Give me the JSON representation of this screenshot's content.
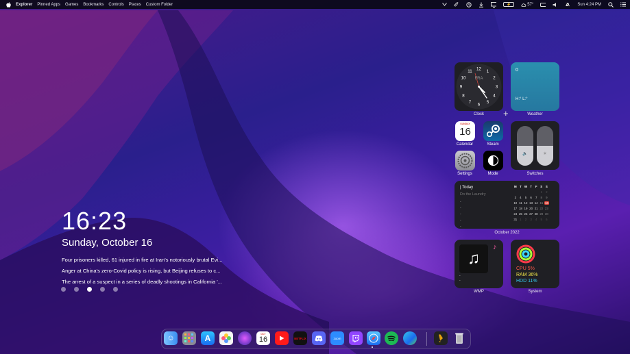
{
  "menubar": {
    "items": [
      "Explorer",
      "Pinned Apps",
      "Games",
      "Bookmarks",
      "Controls",
      "Places",
      "Custom Folder"
    ],
    "temperature": "57°",
    "datetime": "Sun 4:24 PM"
  },
  "lockscreen": {
    "time": "16:23",
    "date": "Sunday, October 16",
    "news": [
      "Four prisoners killed, 61 injured in fire at Iran's notoriously brutal Evi...",
      "Anger at China's zero-Covid policy is rising, but Beijing refuses to c...",
      "The arrest of a suspect in a series of deadly shootings in California '..."
    ],
    "active_page": 3,
    "page_count": 5
  },
  "widgets": {
    "clock": {
      "label": "Clock",
      "city": "FRA",
      "numbers": [
        "12",
        "1",
        "2",
        "3",
        "4",
        "5",
        "6",
        "7",
        "8",
        "9",
        "10",
        "11"
      ]
    },
    "weather": {
      "label": "Weather",
      "temp": "0",
      "hilo": "H:° L:°"
    },
    "calendar_app": {
      "label": "Calendar",
      "weekday": "SUNDAY",
      "day": "16"
    },
    "steam": {
      "label": "Steam"
    },
    "settings": {
      "label": "Settings"
    },
    "mode": {
      "label": "Mode"
    },
    "switches": {
      "label": "Switches",
      "volume_level": 0.5,
      "brightness_level": 0.5
    },
    "calendar_widget": {
      "label": "October 2022",
      "today_label": "Today",
      "event": "Do the Laundry",
      "bullets": [
        "-",
        "-",
        "-",
        "-",
        "-"
      ],
      "weekday_headers": [
        "M",
        "T",
        "W",
        "T",
        "F",
        "S",
        "S"
      ],
      "days": [
        "",
        "",
        "",
        "",
        "",
        "1",
        "2",
        "3",
        "4",
        "5",
        "6",
        "7",
        "8",
        "9",
        "10",
        "11",
        "12",
        "13",
        "14",
        "15",
        "16",
        "17",
        "18",
        "19",
        "20",
        "21",
        "22",
        "23",
        "24",
        "25",
        "26",
        "27",
        "28",
        "29",
        "30",
        "31",
        "1",
        "2",
        "3",
        "4",
        "5",
        "6"
      ],
      "today": "16"
    },
    "wmp": {
      "label": "WMP",
      "lines": [
        "-",
        "-"
      ]
    },
    "system": {
      "label": "System",
      "cpu": "CPU 5%",
      "ram": "RAM 36%",
      "hdd": "HDD 11%"
    }
  },
  "dock": {
    "apps": [
      {
        "name": "Finder"
      },
      {
        "name": "Launchpad"
      },
      {
        "name": "App Store"
      },
      {
        "name": "Photos"
      },
      {
        "name": "Siri"
      },
      {
        "name": "Calendar",
        "month": "OCT",
        "day": "16"
      },
      {
        "name": "YouTube"
      },
      {
        "name": "Netflix",
        "text": "NETFLIX"
      },
      {
        "name": "Discord"
      },
      {
        "name": "Zoom",
        "text": "zoom"
      },
      {
        "name": "Twitch"
      },
      {
        "name": "Safari"
      },
      {
        "name": "Spotify"
      },
      {
        "name": "Edge"
      },
      {
        "name": "Plex"
      },
      {
        "name": "Trash"
      }
    ]
  },
  "colors": {
    "accent": "#e0473c",
    "weather": "#2a86a6",
    "cpu": "#ff5a4a",
    "ram": "#f2e84a",
    "hdd": "#35c6e8"
  }
}
